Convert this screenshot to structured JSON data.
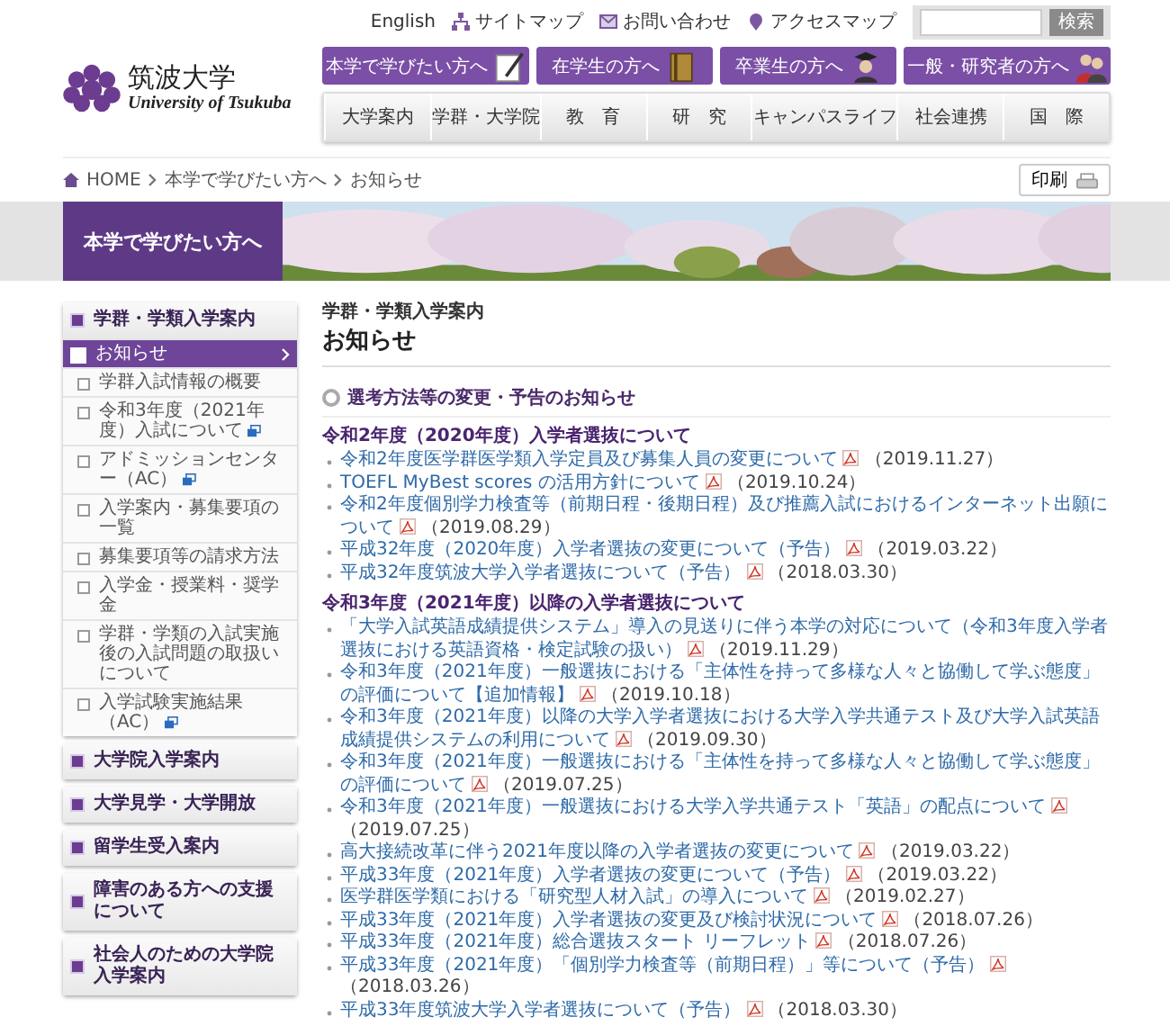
{
  "header": {
    "logo_title": "筑波大学",
    "logo_subtitle": "University of Tsukuba",
    "utility_links": [
      {
        "label": "English",
        "kind": "text"
      },
      {
        "label": "サイトマップ",
        "kind": "sitemap"
      },
      {
        "label": "お問い合わせ",
        "kind": "mail"
      },
      {
        "label": "アクセスマップ",
        "kind": "map"
      }
    ],
    "search_button": "検索",
    "audience_buttons": [
      {
        "label": "本学で学びたい方へ",
        "kind": "pen"
      },
      {
        "label": "在学生の方へ",
        "kind": "book"
      },
      {
        "label": "卒業生の方へ",
        "kind": "graduate"
      },
      {
        "label": "一般・研究者の方へ",
        "kind": "people"
      }
    ],
    "nav": [
      "大学案内",
      "学群・大学院",
      "教　育",
      "研　究",
      "キャンパスライフ",
      "社会連携",
      "国　際"
    ]
  },
  "breadcrumb": [
    "HOME",
    "本学で学びたい方へ",
    "お知らせ"
  ],
  "print_button": "印刷",
  "banner": {
    "title": "本学で学びたい方へ"
  },
  "sidebar": [
    {
      "label": "学群・学類入学案内",
      "children": [
        {
          "label": "お知らせ",
          "selected": true,
          "external": false
        },
        {
          "label": "学群入試情報の概要",
          "selected": false,
          "external": false
        },
        {
          "label": "令和3年度（2021年度）入試について",
          "selected": false,
          "external": true
        },
        {
          "label": "アドミッションセンター（AC）",
          "selected": false,
          "external": true
        },
        {
          "label": "入学案内・募集要項の一覧",
          "selected": false,
          "external": false
        },
        {
          "label": "募集要項等の請求方法",
          "selected": false,
          "external": false
        },
        {
          "label": "入学金・授業料・奨学金",
          "selected": false,
          "external": false
        },
        {
          "label": "学群・学類の入試実施後の入試問題の取扱いについて",
          "selected": false,
          "external": false
        },
        {
          "label": "入学試験実施結果（AC）",
          "selected": false,
          "external": true
        }
      ]
    },
    {
      "label": "大学院入学案内"
    },
    {
      "label": "大学見学・大学開放"
    },
    {
      "label": "留学生受入案内"
    },
    {
      "label": "障害のある方への支援について"
    },
    {
      "label": "社会人のための大学院入学案内"
    }
  ],
  "main": {
    "category": "学群・学類入学案内",
    "title": "お知らせ",
    "section_title": "選考方法等の変更・予告のお知らせ",
    "groups": [
      {
        "heading": "令和2年度（2020年度）入学者選抜について",
        "items": [
          {
            "link": "令和2年度医学群医学類入学定員及び募集人員の変更について",
            "date": "（2019.11.27）"
          },
          {
            "link": "TOEFL MyBest scores の活用方針について",
            "date": "（2019.10.24）"
          },
          {
            "link": "令和2年度個別学力検査等（前期日程・後期日程）及び推薦入試におけるインターネット出願について",
            "date": "（2019.08.29）"
          },
          {
            "link": "平成32年度（2020年度）入学者選抜の変更について（予告）",
            "date": "（2019.03.22）"
          },
          {
            "link": "平成32年度筑波大学入学者選抜について（予告）",
            "date": "（2018.03.30）"
          }
        ]
      },
      {
        "heading": "令和3年度（2021年度）以降の入学者選抜について",
        "items": [
          {
            "link": "「大学入試英語成績提供システム」導入の見送りに伴う本学の対応について（令和3年度入学者選抜における英語資格・検定試験の扱い）",
            "date": "（2019.11.29）"
          },
          {
            "link": "令和3年度（2021年度）一般選抜における「主体性を持って多様な人々と協働して学ぶ態度」の評価について【追加情報】",
            "date": "（2019.10.18）"
          },
          {
            "link": "令和3年度（2021年度）以降の大学入学者選抜における大学入学共通テスト及び大学入試英語成績提供システムの利用について",
            "date": "（2019.09.30）"
          },
          {
            "link": "令和3年度（2021年度）一般選抜における「主体性を持って多様な人々と協働して学ぶ態度」の評価について",
            "date": "（2019.07.25）"
          },
          {
            "link": "令和3年度（2021年度）一般選抜における大学入学共通テスト「英語」の配点について",
            "date": "（2019.07.25）"
          },
          {
            "link": "高大接続改革に伴う2021年度以降の入学者選抜の変更について",
            "date": "（2019.03.22）"
          },
          {
            "link": "平成33年度（2021年度）入学者選抜の変更について（予告）",
            "date": "（2019.03.22）"
          },
          {
            "link": "医学群医学類における「研究型人材入試」の導入について",
            "date": "（2019.02.27）"
          },
          {
            "link": "平成33年度（2021年度）入学者選抜の変更及び検討状況について",
            "date": "（2018.07.26）"
          },
          {
            "link": "平成33年度（2021年度）総合選抜スタート リーフレット",
            "date": "（2018.07.26）"
          },
          {
            "link": "平成33年度（2021年度）「個別学力検査等（前期日程）」等について（予告）",
            "date": "（2018.03.26）"
          },
          {
            "link": "平成33年度筑波大学入学者選抜について（予告）",
            "date": "（2018.03.30）"
          }
        ]
      }
    ]
  }
}
